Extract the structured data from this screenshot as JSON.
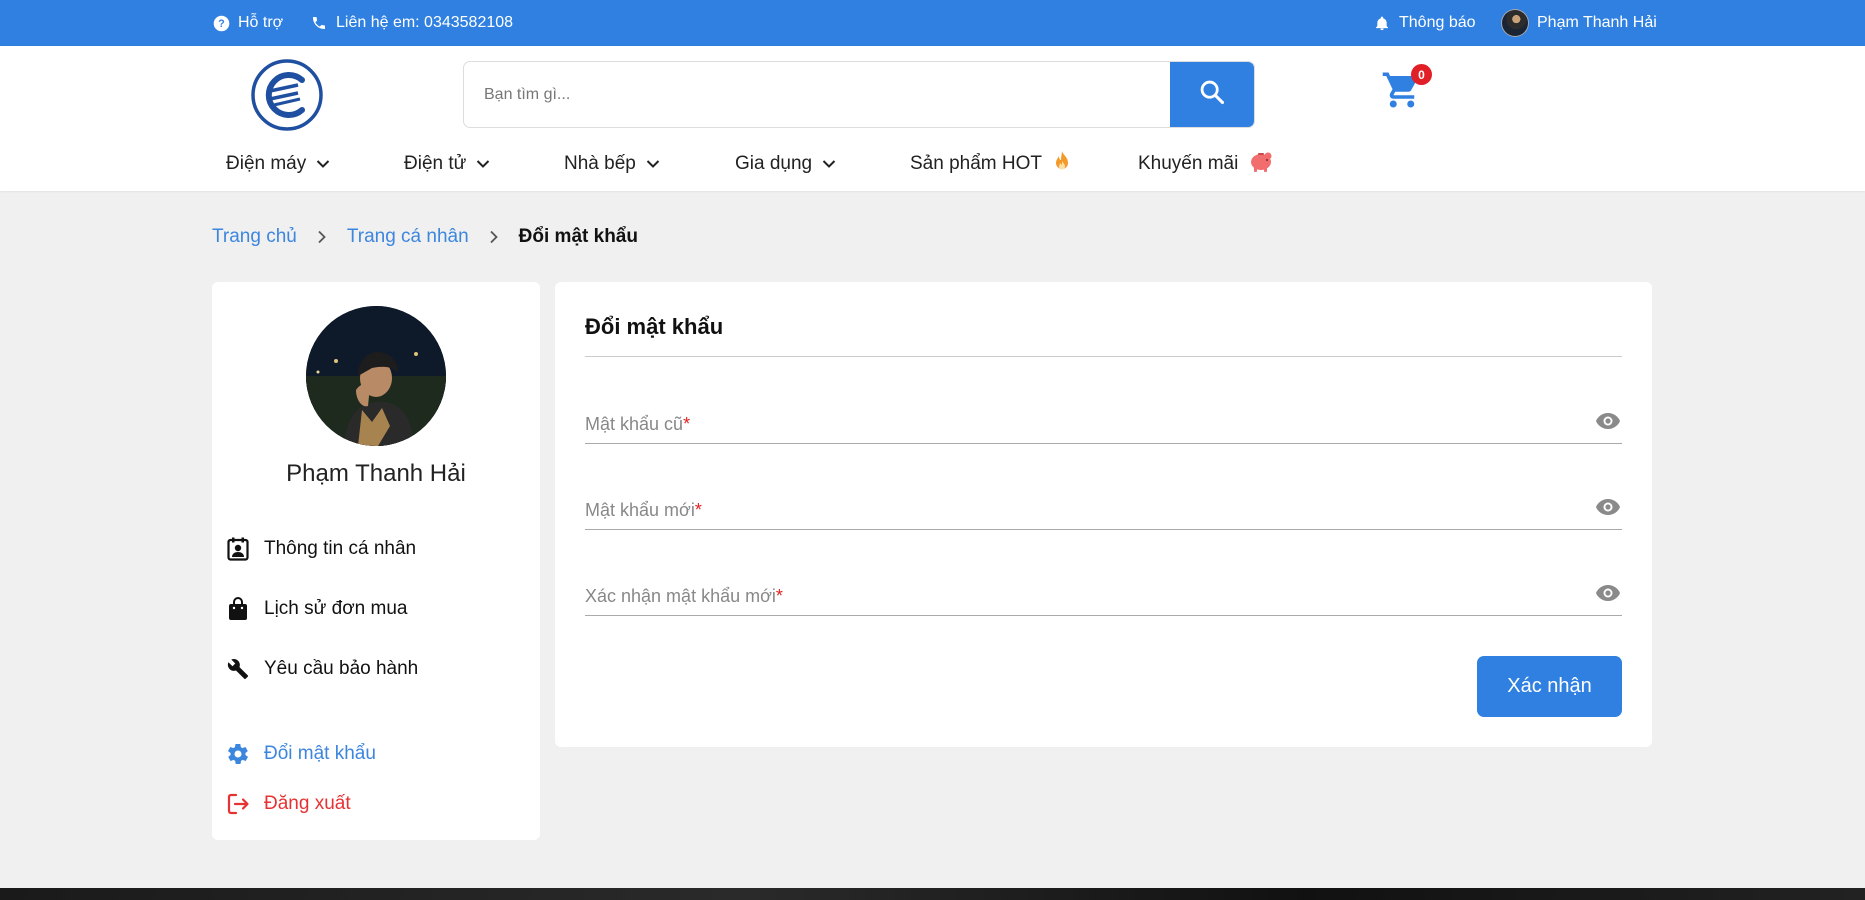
{
  "topbar": {
    "support_label": "Hỗ trợ",
    "contact_label": "Liên hệ em: 0343582108",
    "notification_label": "Thông báo",
    "user_name": "Phạm Thanh Hải"
  },
  "header": {
    "search_placeholder": "Bạn tìm gì...",
    "cart_count": "0"
  },
  "nav": {
    "items": [
      {
        "label": "Điện máy",
        "icon": "chevron-down-icon"
      },
      {
        "label": "Điện tử",
        "icon": "chevron-down-icon"
      },
      {
        "label": "Nhà bếp",
        "icon": "chevron-down-icon"
      },
      {
        "label": "Gia dụng",
        "icon": "chevron-down-icon"
      },
      {
        "label": "Sản phẩm HOT",
        "icon": "fire-icon"
      },
      {
        "label": "Khuyến mãi",
        "icon": "piggy-bank-icon"
      }
    ]
  },
  "breadcrumb": {
    "home": "Trang chủ",
    "profile": "Trang cá nhân",
    "current": "Đổi mật khẩu"
  },
  "sidebar": {
    "name": "Phạm Thanh Hải",
    "menu": [
      {
        "label": "Thông tin cá nhân",
        "icon": "contact-card-icon"
      },
      {
        "label": "Lịch sử đơn mua",
        "icon": "shopping-bag-icon"
      },
      {
        "label": "Yêu cầu bảo hành",
        "icon": "wrench-icon"
      },
      {
        "label": "Đổi mật khẩu",
        "icon": "gear-icon"
      },
      {
        "label": "Đăng xuất",
        "icon": "logout-icon"
      }
    ]
  },
  "form": {
    "title": "Đổi mật khẩu",
    "fields": [
      {
        "label": "Mật khẩu cũ",
        "required": "*"
      },
      {
        "label": "Mật khẩu mới",
        "required": "*"
      },
      {
        "label": "Xác nhận mật khẩu mới",
        "required": "*"
      }
    ],
    "submit_label": "Xác nhận"
  },
  "colors": {
    "primary": "#2f80e0",
    "link": "#3c86de",
    "danger": "#e63232",
    "badge": "#e01f26",
    "background": "#f0f0f0"
  }
}
